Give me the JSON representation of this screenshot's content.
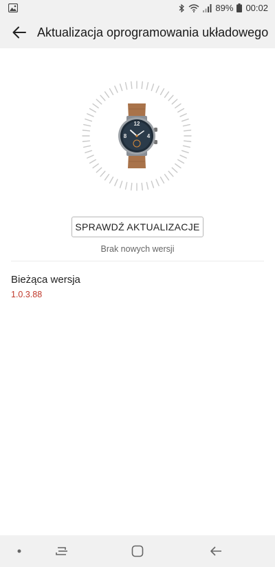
{
  "status_bar": {
    "battery_percent": "89%",
    "time": "00:02",
    "icons": [
      "image-icon",
      "bluetooth-icon",
      "wifi-icon",
      "signal-icon",
      "battery-icon"
    ]
  },
  "header": {
    "title": "Aktualizacja oprogramowania układowego",
    "back_icon": "arrow-left-icon"
  },
  "device_image": "watch-image",
  "check_button": {
    "label": "SPRAWDŹ AKTUALIZACJE"
  },
  "update_status": "Brak nowych wersji",
  "current_version": {
    "label": "Bieżąca wersja",
    "value": "1.0.3.88"
  },
  "nav_bar": {
    "items": [
      "dot-icon",
      "recents-icon",
      "home-icon",
      "back-icon"
    ]
  },
  "colors": {
    "accent_version": "#c0392b",
    "bar_background": "#f1f1f1"
  }
}
